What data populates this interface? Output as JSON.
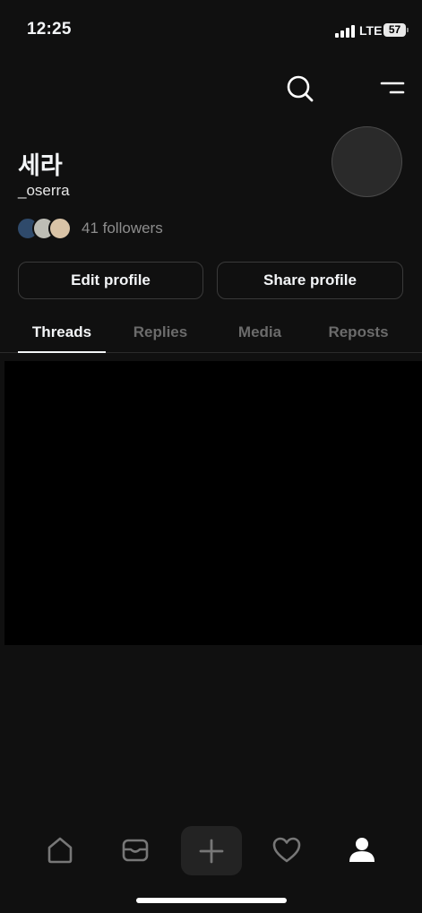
{
  "status_bar": {
    "time": "12:25",
    "network": "LTE",
    "battery": "57"
  },
  "top_bar": {
    "icons": [
      "search-icon",
      "menu-icon"
    ]
  },
  "profile": {
    "display_name": "세라",
    "handle": "_oserra",
    "followers_text": "41 followers",
    "follower_avatar_colors": [
      "#2f4a6b",
      "#bdbdb5",
      "#d9c3a6"
    ]
  },
  "actions": {
    "edit_profile": "Edit profile",
    "share_profile": "Share profile"
  },
  "tabs": [
    {
      "label": "Threads",
      "active": true
    },
    {
      "label": "Replies",
      "active": false
    },
    {
      "label": "Media",
      "active": false
    },
    {
      "label": "Reposts",
      "active": false
    }
  ],
  "bottom_nav": {
    "items": [
      "home-icon",
      "inbox-icon",
      "compose-icon",
      "activity-heart-icon",
      "profile-icon"
    ],
    "active": "profile-icon"
  },
  "colors": {
    "background": "#101010",
    "text_primary": "#f3f5f7",
    "text_secondary": "#8d8d8d",
    "border": "#3a3a3a"
  }
}
